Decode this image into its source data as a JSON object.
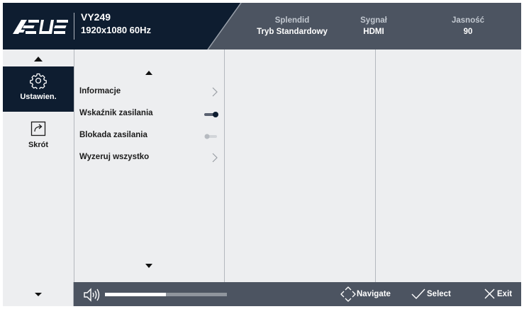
{
  "header": {
    "brand": "ASUS",
    "model": "VY249",
    "resolution": "1920x1080 60Hz",
    "stats": [
      {
        "label": "Splendid",
        "value": "Tryb Standardowy"
      },
      {
        "label": "Sygnał",
        "value": "HDMI"
      },
      {
        "label": "Jasność",
        "value": "90"
      }
    ]
  },
  "nav": {
    "items": [
      {
        "label": "Ustawien.",
        "icon": "gear-icon",
        "active": true
      },
      {
        "label": "Skrót",
        "icon": "shortcut-icon",
        "active": false
      }
    ]
  },
  "menu": {
    "items": [
      {
        "label": "Informacje",
        "control": "chevron"
      },
      {
        "label": "Wskaźnik zasilania",
        "control": "toggle",
        "on": true
      },
      {
        "label": "Blokada zasilania",
        "control": "toggle",
        "on": false
      },
      {
        "label": "Wyzeruj wszystko",
        "control": "chevron"
      }
    ]
  },
  "volume": {
    "level": 0.5
  },
  "hints": [
    {
      "label": "Navigate",
      "icon": "navigate-icon"
    },
    {
      "label": "Select",
      "icon": "checkmark-icon"
    },
    {
      "label": "Exit",
      "icon": "close-icon"
    }
  ],
  "colors": {
    "header_dark": "#0e1d30",
    "header_gray": "#4c5461",
    "panel_bg": "#edeef0",
    "active_nav": "#0e1d30"
  }
}
